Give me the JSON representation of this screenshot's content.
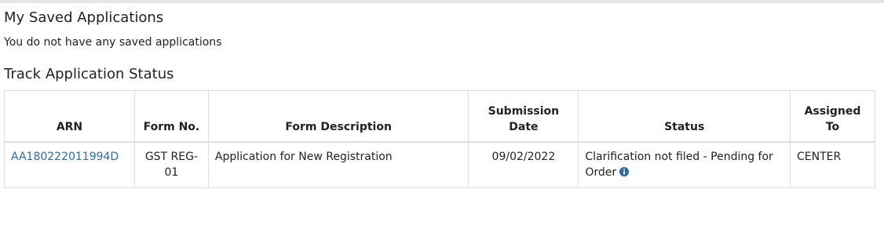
{
  "saved_applications": {
    "title": "My Saved Applications",
    "empty_message": "You do not have any saved applications"
  },
  "track_status": {
    "title": "Track Application Status",
    "columns": [
      "ARN",
      "Form No.",
      "Form Description",
      "Submission Date",
      "Status",
      "Assigned To"
    ],
    "rows": [
      {
        "arn": "AA180222011994D",
        "form_no": "GST REG-01",
        "form_description": "Application for New Registration",
        "submission_date": "09/02/2022",
        "status": "Clarification not filed - Pending for Order",
        "status_icon": "info-circle-icon",
        "assigned_to": "CENTER"
      }
    ]
  },
  "colors": {
    "link": "#2c6ba8",
    "info_icon": "#2c6ba8",
    "border": "#dddddd",
    "top_strip": "#e4e6e8"
  }
}
